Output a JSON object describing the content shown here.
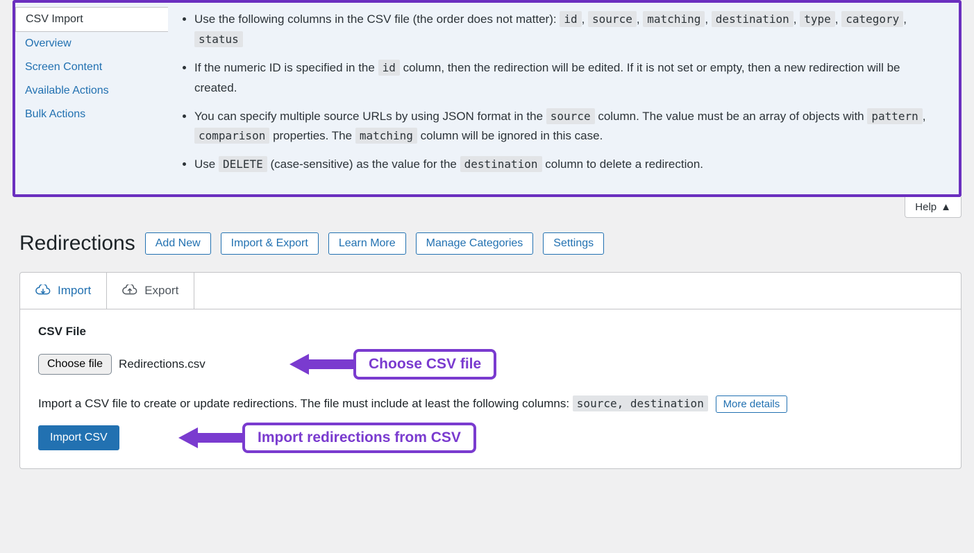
{
  "help_panel": {
    "sidebar": [
      {
        "label": "CSV Import",
        "active": true
      },
      {
        "label": "Overview",
        "active": false
      },
      {
        "label": "Screen Content",
        "active": false
      },
      {
        "label": "Available Actions",
        "active": false
      },
      {
        "label": "Bulk Actions",
        "active": false
      }
    ],
    "bullets": {
      "b1_pre": "Use the following columns in the CSV file (the order does not matter): ",
      "b1_codes": [
        "id",
        "source",
        "matching",
        "destination",
        "type",
        "category",
        "status"
      ],
      "b2_pre": "If the numeric ID is specified in the ",
      "b2_code": "id",
      "b2_post": " column, then the redirection will be edited. If it is not set or empty, then a new redirection will be created.",
      "b3_pre": "You can specify multiple source URLs by using JSON format in the ",
      "b3_code1": "source",
      "b3_mid1": " column. The value must be an array of objects with ",
      "b3_code2": "pattern",
      "b3_comma": ", ",
      "b3_code3": "comparison",
      "b3_mid2": " properties. The ",
      "b3_code4": "matching",
      "b3_post": " column will be ignored in this case.",
      "b4_pre": "Use ",
      "b4_code1": "DELETE",
      "b4_mid": " (case-sensitive) as the value for the ",
      "b4_code2": "destination",
      "b4_post": " column to delete a redirection."
    }
  },
  "help_tab_label": "Help",
  "page_title": "Redirections",
  "header_buttons": [
    "Add New",
    "Import & Export",
    "Learn More",
    "Manage Categories",
    "Settings"
  ],
  "tabs": {
    "import": "Import",
    "export": "Export"
  },
  "panel": {
    "section_title": "CSV File",
    "choose_file_label": "Choose file",
    "chosen_file_name": "Redirections.csv",
    "desc_pre": "Import a CSV file to create or update redirections. The file must include at least the following columns: ",
    "desc_code": "source, destination",
    "more_details_label": "More details",
    "import_btn_label": "Import CSV"
  },
  "annotations": {
    "choose": "Choose CSV file",
    "import": "Import redirections from CSV"
  }
}
